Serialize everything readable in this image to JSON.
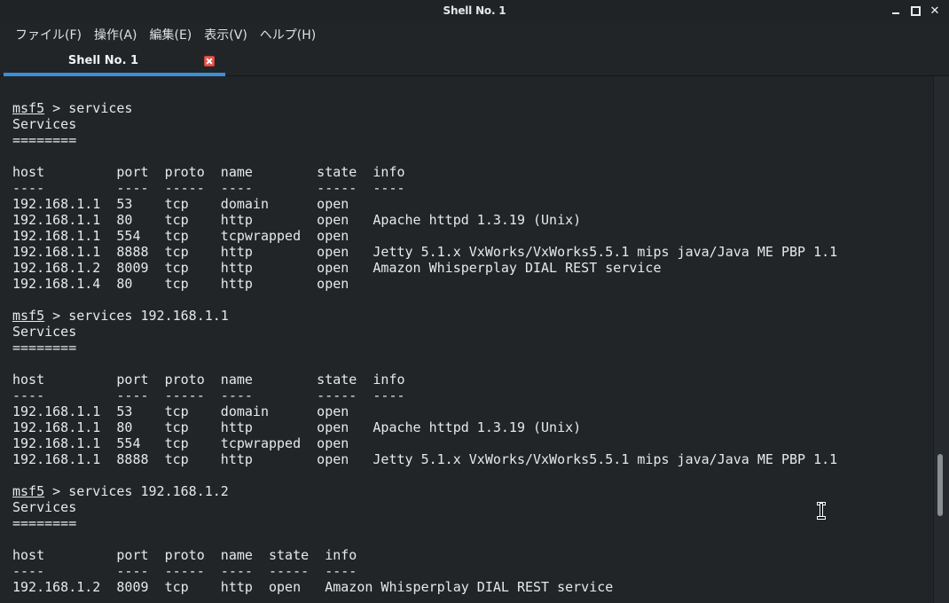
{
  "window": {
    "title": "Shell No. 1",
    "controls": {
      "minimize": "minimize",
      "maximize": "maximize",
      "close": "✕"
    }
  },
  "menu": [
    "ファイル(F)",
    "操作(A)",
    "編集(E)",
    "表示(V)",
    "ヘルプ(H)"
  ],
  "tabs": [
    {
      "label": "Shell No. 1",
      "active": true
    }
  ],
  "colors": {
    "accent": "#3a8fd8",
    "close_badge": "#e8554a",
    "background": "#222528"
  },
  "terminal": {
    "lines": [
      {
        "prompt": "msf5",
        "text": " > services"
      },
      {
        "text": "Services"
      },
      {
        "text": "========"
      },
      {
        "text": ""
      },
      {
        "text": "host         port  proto  name        state  info"
      },
      {
        "text": "----         ----  -----  ----        -----  ----"
      },
      {
        "text": "192.168.1.1  53    tcp    domain      open"
      },
      {
        "text": "192.168.1.1  80    tcp    http        open   Apache httpd 1.3.19 (Unix)"
      },
      {
        "text": "192.168.1.1  554   tcp    tcpwrapped  open"
      },
      {
        "text": "192.168.1.1  8888  tcp    http        open   Jetty 5.1.x VxWorks/VxWorks5.5.1 mips java/Java ME PBP 1.1"
      },
      {
        "text": "192.168.1.2  8009  tcp    http        open   Amazon Whisperplay DIAL REST service"
      },
      {
        "text": "192.168.1.4  80    tcp    http        open"
      },
      {
        "text": ""
      },
      {
        "prompt": "msf5",
        "text": " > services 192.168.1.1"
      },
      {
        "text": "Services"
      },
      {
        "text": "========"
      },
      {
        "text": ""
      },
      {
        "text": "host         port  proto  name        state  info"
      },
      {
        "text": "----         ----  -----  ----        -----  ----"
      },
      {
        "text": "192.168.1.1  53    tcp    domain      open"
      },
      {
        "text": "192.168.1.1  80    tcp    http        open   Apache httpd 1.3.19 (Unix)"
      },
      {
        "text": "192.168.1.1  554   tcp    tcpwrapped  open"
      },
      {
        "text": "192.168.1.1  8888  tcp    http        open   Jetty 5.1.x VxWorks/VxWorks5.5.1 mips java/Java ME PBP 1.1"
      },
      {
        "text": ""
      },
      {
        "prompt": "msf5",
        "text": " > services 192.168.1.2"
      },
      {
        "text": "Services"
      },
      {
        "text": "========"
      },
      {
        "text": ""
      },
      {
        "text": "host         port  proto  name  state  info"
      },
      {
        "text": "----         ----  -----  ----  -----  ----"
      },
      {
        "text": "192.168.1.2  8009  tcp    http  open   Amazon Whisperplay DIAL REST service"
      }
    ]
  }
}
